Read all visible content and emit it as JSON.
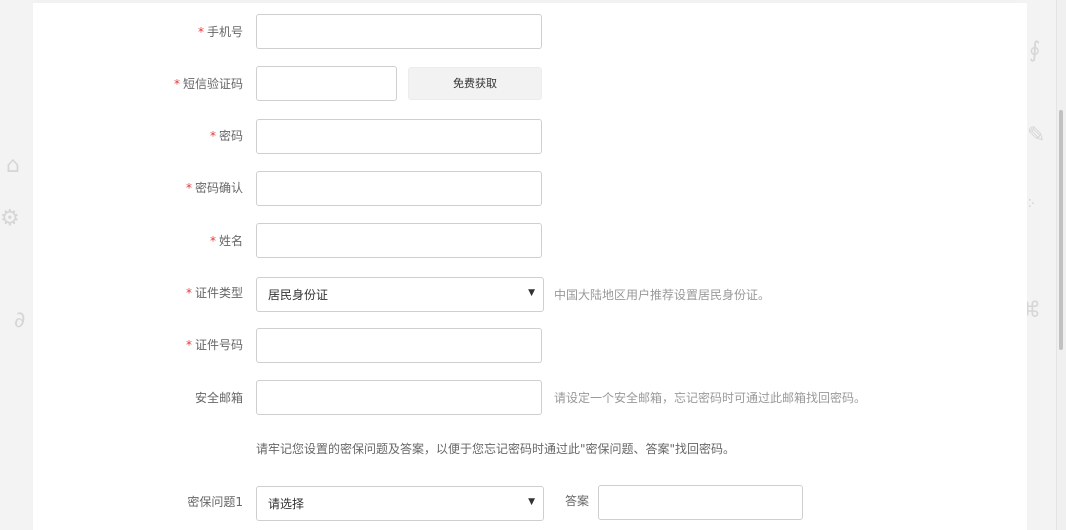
{
  "form": {
    "phone": {
      "label": "手机号",
      "required": "*"
    },
    "sms_code": {
      "label": "短信验证码",
      "required": "*",
      "button": "免费获取"
    },
    "password": {
      "label": "密码",
      "required": "*"
    },
    "password_confirm": {
      "label": "密码确认",
      "required": "*"
    },
    "name": {
      "label": "姓名",
      "required": "*"
    },
    "id_type": {
      "label": "证件类型",
      "required": "*",
      "selected": "居民身份证",
      "hint": "中国大陆地区用户推荐设置居民身份证。"
    },
    "id_number": {
      "label": "证件号码",
      "required": "*"
    },
    "email": {
      "label": "安全邮箱",
      "hint": "请设定一个安全邮箱，忘记密码时可通过此邮箱找回密码。"
    },
    "security_notice": "请牢记您设置的密保问题及答案，以便于您忘记密码时通过此\"密保问题、答案\"找回密码。",
    "question1": {
      "label": "密保问题1",
      "selected": "请选择",
      "answer_label": "答案"
    }
  },
  "icons": {
    "select_arrow": "▼",
    "doodles": [
      "camera-icon",
      "tag-icon",
      "pencil-icon",
      "sparkle-icon",
      "clip-icon"
    ]
  },
  "colors": {
    "required": "#e4393c",
    "border": "#cfcfcf",
    "button_bg": "#f2f2f2",
    "hint": "#999999",
    "background": "#f2f2f2"
  }
}
